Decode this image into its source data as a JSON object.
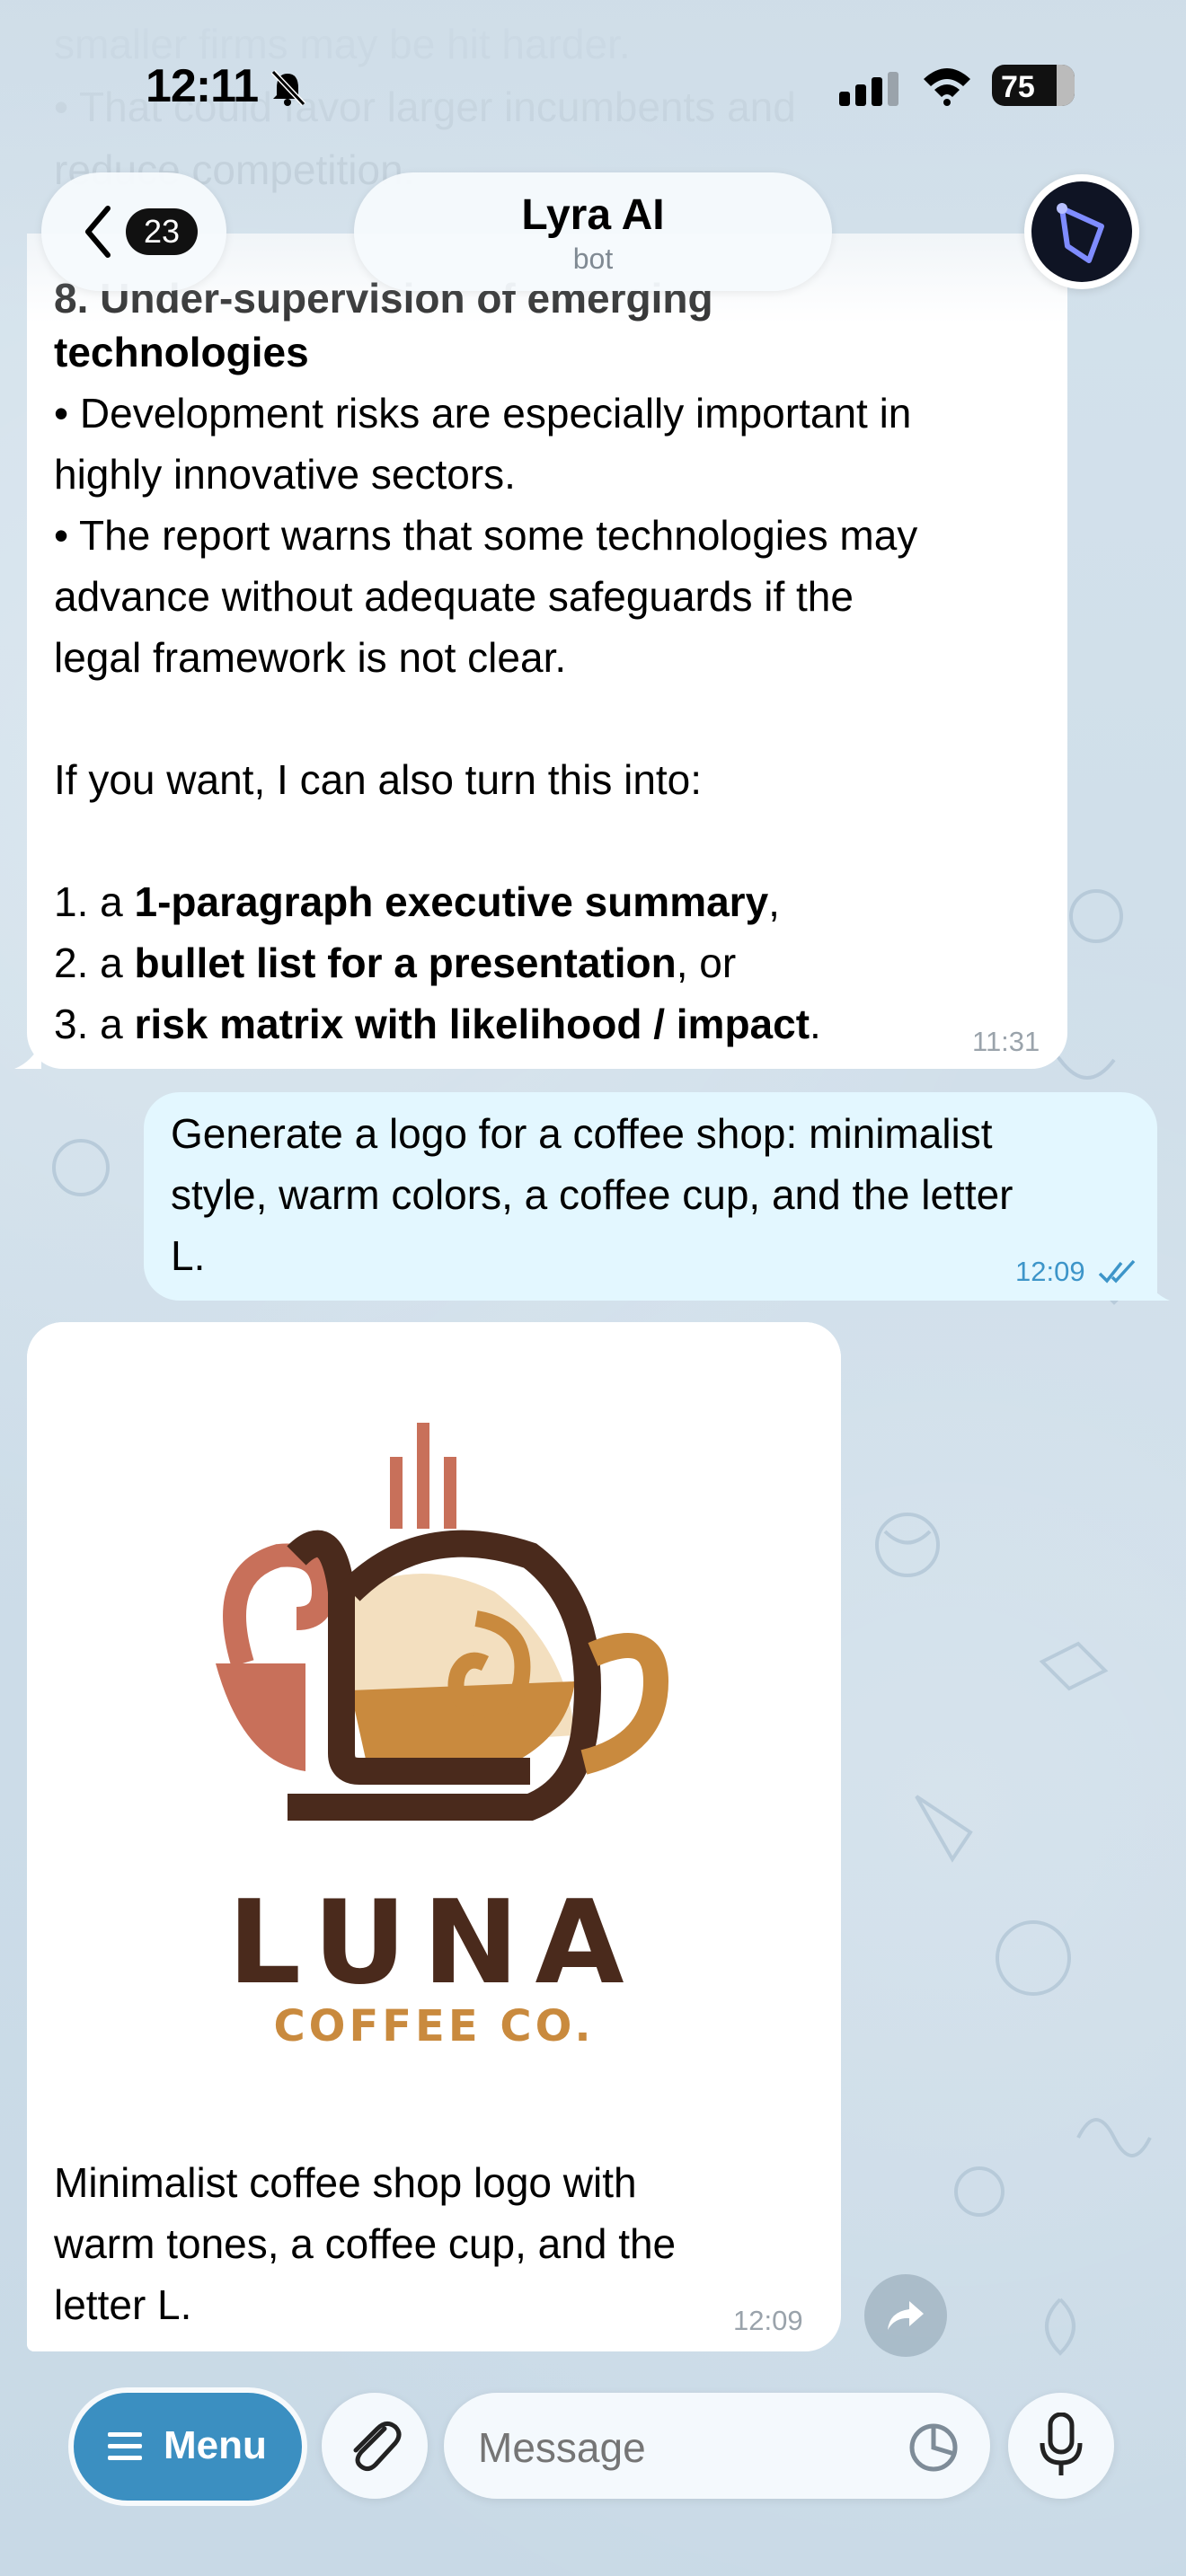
{
  "status_bar": {
    "time": "12:11",
    "battery": "75"
  },
  "header": {
    "back_count": "23",
    "title": "Lyra AI",
    "subtitle": "bot"
  },
  "chat": {
    "ghost_lines": [
      "smaller firms may be hit harder.",
      "• That could favor larger incumbents and",
      "reduce competition."
    ],
    "msg1": {
      "heading_a": "8. Under-supervision of emerging",
      "heading_b": "technologies",
      "bullet1_a": "• Development risks are especially important in",
      "bullet1_b": "highly innovative sectors.",
      "bullet2_a": "• The report warns that some technologies may",
      "bullet2_b": "advance without adequate safeguards if the",
      "bullet2_c": "legal framework is not clear.",
      "offer": "If you want, I can also turn this into:",
      "opt1_pre": "1. a ",
      "opt1_b": "1-paragraph executive summary",
      "opt1_post": ",",
      "opt2_pre": "2. a ",
      "opt2_b": "bullet list for a presentation",
      "opt2_post": ", or",
      "opt3_pre": "3. a ",
      "opt3_b": "risk matrix with likelihood / impact",
      "opt3_post": ".",
      "time": "11:31"
    },
    "msg2": {
      "line1": "Generate a logo for a coffee shop: minimalist",
      "line2": "style, warm colors, a coffee cup, and the letter",
      "line3": "L.",
      "time": "12:09"
    },
    "msg3": {
      "logo_name": "LUNA",
      "logo_tagline": "COFFEE CO.",
      "caption_a": "Minimalist coffee shop logo with",
      "caption_b": "warm tones, a coffee cup, and the",
      "caption_c": "letter L.",
      "time": "12:09"
    }
  },
  "input_bar": {
    "menu_label": "Menu",
    "placeholder": "Message"
  },
  "icons": [
    "bell-off-icon",
    "signal-icon",
    "wifi-icon",
    "battery-icon",
    "chevron-left-icon",
    "constellation-icon",
    "share-icon",
    "menu-icon",
    "paperclip-icon",
    "sticker-icon",
    "microphone-icon",
    "double-check-icon"
  ],
  "colors": {
    "accent": "#3b8fc1",
    "outgoing_bubble": "#e3f7ff",
    "logo_brown": "#4a2a1c",
    "logo_terracotta": "#c8705a",
    "logo_caramel": "#c98a3e",
    "logo_cream": "#f3dfbf"
  }
}
